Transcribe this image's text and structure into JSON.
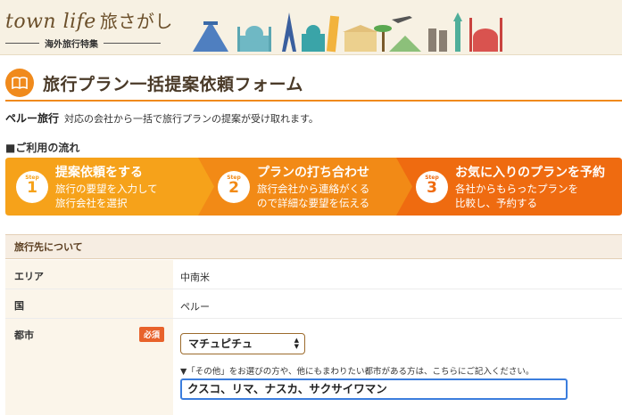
{
  "header": {
    "logo_text": "town life",
    "logo_jp": "旅さがし",
    "logo_sub": "海外旅行特集"
  },
  "page_title": "旅行プラン一括提案依頼フォーム",
  "intro": {
    "country": "ペルー旅行",
    "text": "対応の会社から一括で旅行プランの提案が受け取れます。"
  },
  "flow_heading": "■ご利用の流れ",
  "steps": [
    {
      "label": "Step",
      "number": "1",
      "title": "提案依頼をする",
      "desc1": "旅行の要望を入力して",
      "desc2": "旅行会社を選択",
      "color": "#f6a21a"
    },
    {
      "label": "Step",
      "number": "2",
      "title": "プランの打ち合わせ",
      "desc1": "旅行会社から連絡がくる",
      "desc2": "ので詳細な要望を伝える",
      "color": "#f28a16"
    },
    {
      "label": "Step",
      "number": "3",
      "title": "お気に入りのプランを予約",
      "desc1": "各社からもらったプランを",
      "desc2": "比較し、予約する",
      "color": "#ef6b10"
    }
  ],
  "form": {
    "section_title": "旅行先について",
    "area_label": "エリア",
    "area_value": "中南米",
    "country_label": "国",
    "country_value": "ペルー",
    "city_label": "都市",
    "required_badge": "必須",
    "city_select_value": "マチュピチュ",
    "city_note": "▼「その他」をお選びの方や、他にもまわりたい都市がある方は、こちらにご記入ください。",
    "city_other_value": "クスコ、リマ、ナスカ、サクサイワマン"
  },
  "colors": {
    "accent": "#f08a1c",
    "brand_text": "#6b4f2a",
    "label_bg": "#fbf5ea",
    "focus_border": "#3b7ddd"
  }
}
